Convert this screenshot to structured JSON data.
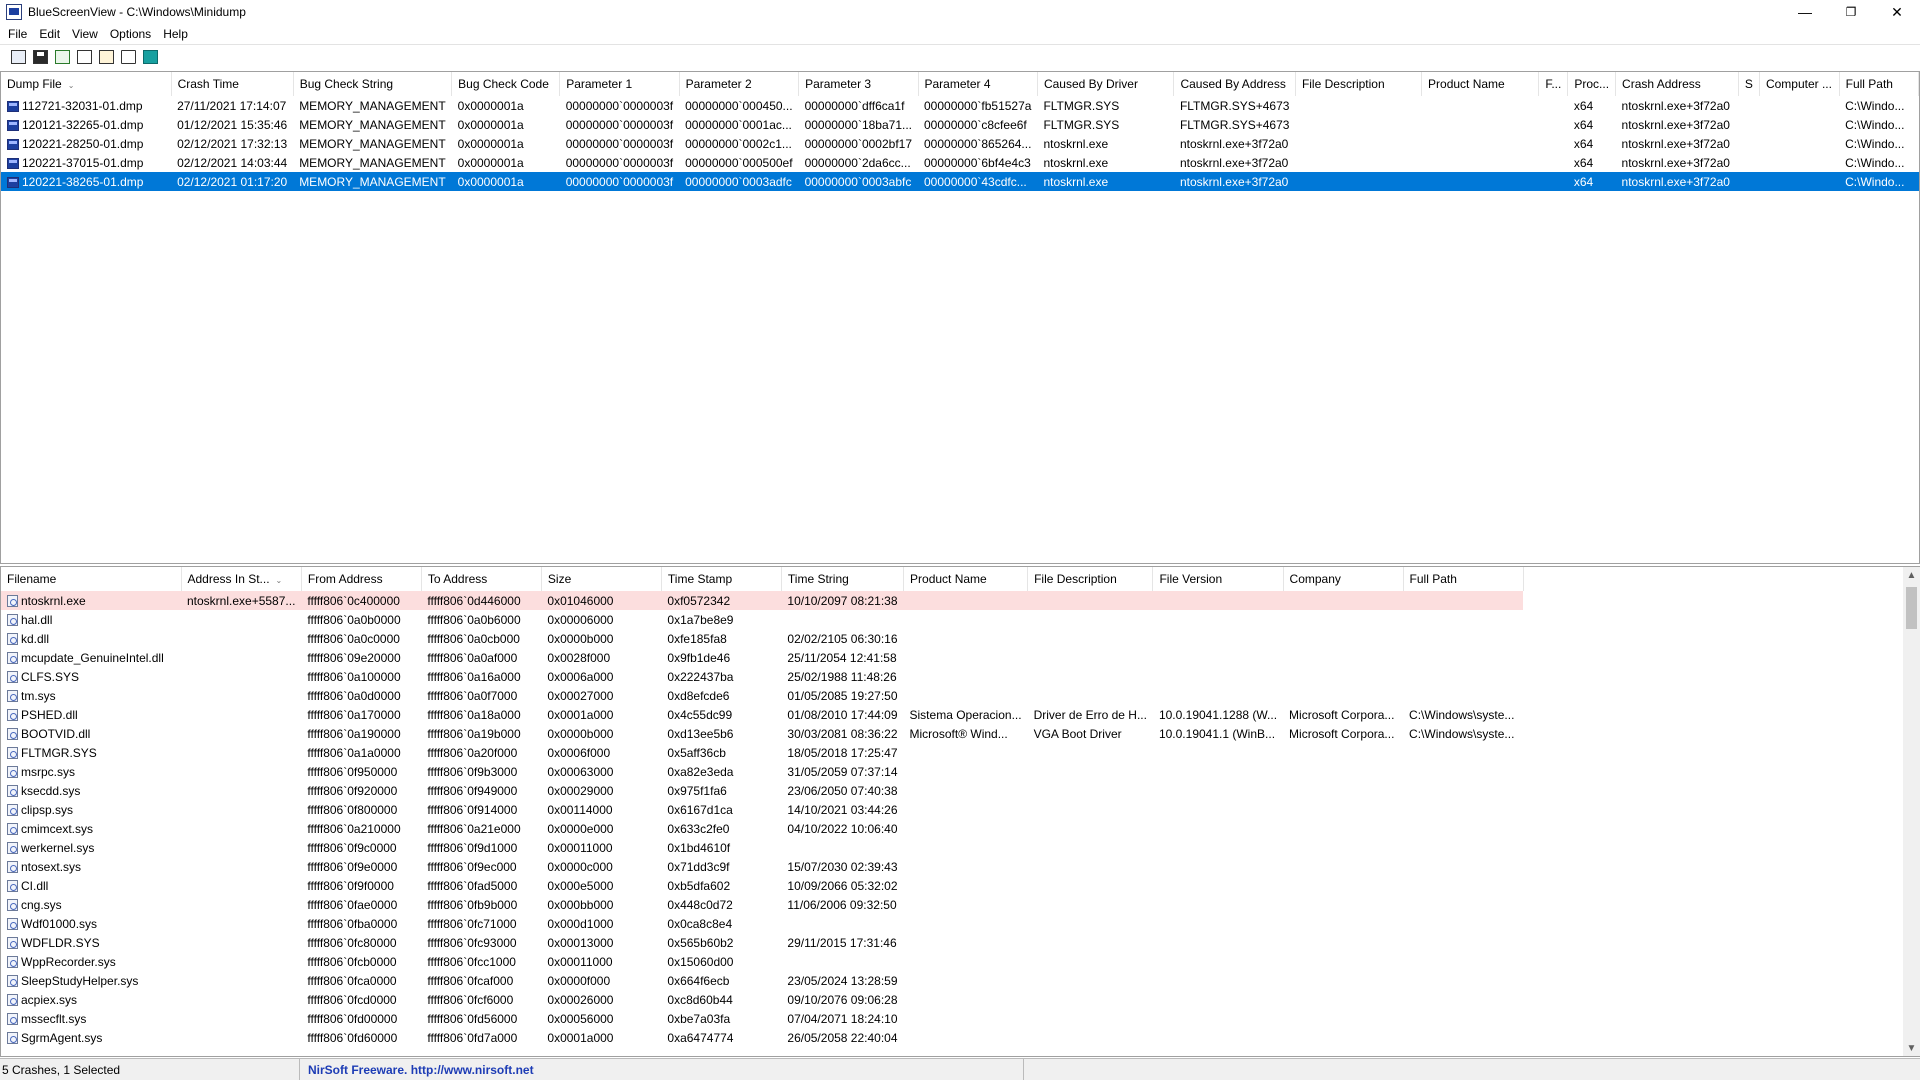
{
  "window": {
    "app_name": "BlueScreenView",
    "path": "C:\\Windows\\Minidump",
    "title_separator": " - "
  },
  "window_controls": {
    "minimize": "—",
    "restore": "❐",
    "close": "✕"
  },
  "menu": [
    "File",
    "Edit",
    "View",
    "Options",
    "Help"
  ],
  "toolbar": [
    "html-report-icon",
    "save-icon",
    "refresh-icon",
    "copy-icon",
    "properties-icon",
    "find-icon",
    "exit-icon"
  ],
  "crashes": {
    "columns": [
      "Dump File",
      "Crash Time",
      "Bug Check String",
      "Bug Check Code",
      "Parameter 1",
      "Parameter 2",
      "Parameter 3",
      "Parameter 4",
      "Caused By Driver",
      "Caused By Address",
      "File Description",
      "Product Name",
      "F...",
      "Proc...",
      "Crash Address",
      "S",
      "Computer ...",
      "Full Path"
    ],
    "sort_indicator": "⌄",
    "rows": [
      [
        "112721-32031-01.dmp",
        "27/11/2021 17:14:07",
        "MEMORY_MANAGEMENT",
        "0x0000001a",
        "00000000`0000003f",
        "00000000`000450...",
        "00000000`dff6ca1f",
        "00000000`fb51527a",
        "FLTMGR.SYS",
        "FLTMGR.SYS+4673",
        "",
        "",
        "",
        "x64",
        "ntoskrnl.exe+3f72a0",
        "",
        "",
        "C:\\Windo..."
      ],
      [
        "120121-32265-01.dmp",
        "01/12/2021 15:35:46",
        "MEMORY_MANAGEMENT",
        "0x0000001a",
        "00000000`0000003f",
        "00000000`0001ac...",
        "00000000`18ba71...",
        "00000000`c8cfee6f",
        "FLTMGR.SYS",
        "FLTMGR.SYS+4673",
        "",
        "",
        "",
        "x64",
        "ntoskrnl.exe+3f72a0",
        "",
        "",
        "C:\\Windo..."
      ],
      [
        "120221-28250-01.dmp",
        "02/12/2021 17:32:13",
        "MEMORY_MANAGEMENT",
        "0x0000001a",
        "00000000`0000003f",
        "00000000`0002c1...",
        "00000000`0002bf17",
        "00000000`865264...",
        "ntoskrnl.exe",
        "ntoskrnl.exe+3f72a0",
        "",
        "",
        "",
        "x64",
        "ntoskrnl.exe+3f72a0",
        "",
        "",
        "C:\\Windo..."
      ],
      [
        "120221-37015-01.dmp",
        "02/12/2021 14:03:44",
        "MEMORY_MANAGEMENT",
        "0x0000001a",
        "00000000`0000003f",
        "00000000`000500ef",
        "00000000`2da6cc...",
        "00000000`6bf4e4c3",
        "ntoskrnl.exe",
        "ntoskrnl.exe+3f72a0",
        "",
        "",
        "",
        "x64",
        "ntoskrnl.exe+3f72a0",
        "",
        "",
        "C:\\Windo..."
      ],
      [
        "120221-38265-01.dmp",
        "02/12/2021 01:17:20",
        "MEMORY_MANAGEMENT",
        "0x0000001a",
        "00000000`0000003f",
        "00000000`0003adfc",
        "00000000`0003abfc",
        "00000000`43cdfc...",
        "ntoskrnl.exe",
        "ntoskrnl.exe+3f72a0",
        "",
        "",
        "",
        "x64",
        "ntoskrnl.exe+3f72a0",
        "",
        "",
        "C:\\Windo..."
      ]
    ],
    "selected_index": 4
  },
  "drivers": {
    "columns": [
      "Filename",
      "Address In St...",
      "From Address",
      "To Address",
      "Size",
      "Time Stamp",
      "Time String",
      "Product Name",
      "File Description",
      "File Version",
      "Company",
      "Full Path"
    ],
    "sort_indicator": "⌄",
    "highlight_index": 0,
    "rows": [
      [
        "ntoskrnl.exe",
        "ntoskrnl.exe+5587...",
        "fffff806`0c400000",
        "fffff806`0d446000",
        "0x01046000",
        "0xf0572342",
        "10/10/2097 08:21:38",
        "",
        "",
        "",
        "",
        ""
      ],
      [
        "hal.dll",
        "",
        "fffff806`0a0b0000",
        "fffff806`0a0b6000",
        "0x00006000",
        "0x1a7be8e9",
        "",
        "",
        "",
        "",
        "",
        ""
      ],
      [
        "kd.dll",
        "",
        "fffff806`0a0c0000",
        "fffff806`0a0cb000",
        "0x0000b000",
        "0xfe185fa8",
        "02/02/2105 06:30:16",
        "",
        "",
        "",
        "",
        ""
      ],
      [
        "mcupdate_GenuineIntel.dll",
        "",
        "fffff806`09e20000",
        "fffff806`0a0af000",
        "0x0028f000",
        "0x9fb1de46",
        "25/11/2054 12:41:58",
        "",
        "",
        "",
        "",
        ""
      ],
      [
        "CLFS.SYS",
        "",
        "fffff806`0a100000",
        "fffff806`0a16a000",
        "0x0006a000",
        "0x222437ba",
        "25/02/1988 11:48:26",
        "",
        "",
        "",
        "",
        ""
      ],
      [
        "tm.sys",
        "",
        "fffff806`0a0d0000",
        "fffff806`0a0f7000",
        "0x00027000",
        "0xd8efcde6",
        "01/05/2085 19:27:50",
        "",
        "",
        "",
        "",
        ""
      ],
      [
        "PSHED.dll",
        "",
        "fffff806`0a170000",
        "fffff806`0a18a000",
        "0x0001a000",
        "0x4c55dc99",
        "01/08/2010 17:44:09",
        "Sistema Operacion...",
        "Driver de Erro de H...",
        "10.0.19041.1288 (W...",
        "Microsoft Corpora...",
        "C:\\Windows\\syste..."
      ],
      [
        "BOOTVID.dll",
        "",
        "fffff806`0a190000",
        "fffff806`0a19b000",
        "0x0000b000",
        "0xd13ee5b6",
        "30/03/2081 08:36:22",
        "Microsoft® Wind...",
        "VGA Boot Driver",
        "10.0.19041.1 (WinB...",
        "Microsoft Corpora...",
        "C:\\Windows\\syste..."
      ],
      [
        "FLTMGR.SYS",
        "",
        "fffff806`0a1a0000",
        "fffff806`0a20f000",
        "0x0006f000",
        "0x5aff36cb",
        "18/05/2018 17:25:47",
        "",
        "",
        "",
        "",
        ""
      ],
      [
        "msrpc.sys",
        "",
        "fffff806`0f950000",
        "fffff806`0f9b3000",
        "0x00063000",
        "0xa82e3eda",
        "31/05/2059 07:37:14",
        "",
        "",
        "",
        "",
        ""
      ],
      [
        "ksecdd.sys",
        "",
        "fffff806`0f920000",
        "fffff806`0f949000",
        "0x00029000",
        "0x975f1fa6",
        "23/06/2050 07:40:38",
        "",
        "",
        "",
        "",
        ""
      ],
      [
        "clipsp.sys",
        "",
        "fffff806`0f800000",
        "fffff806`0f914000",
        "0x00114000",
        "0x6167d1ca",
        "14/10/2021 03:44:26",
        "",
        "",
        "",
        "",
        ""
      ],
      [
        "cmimcext.sys",
        "",
        "fffff806`0a210000",
        "fffff806`0a21e000",
        "0x0000e000",
        "0x633c2fe0",
        "04/10/2022 10:06:40",
        "",
        "",
        "",
        "",
        ""
      ],
      [
        "werkernel.sys",
        "",
        "fffff806`0f9c0000",
        "fffff806`0f9d1000",
        "0x00011000",
        "0x1bd4610f",
        "",
        "",
        "",
        "",
        "",
        ""
      ],
      [
        "ntosext.sys",
        "",
        "fffff806`0f9e0000",
        "fffff806`0f9ec000",
        "0x0000c000",
        "0x71dd3c9f",
        "15/07/2030 02:39:43",
        "",
        "",
        "",
        "",
        ""
      ],
      [
        "CI.dll",
        "",
        "fffff806`0f9f0000",
        "fffff806`0fad5000",
        "0x000e5000",
        "0xb5dfa602",
        "10/09/2066 05:32:02",
        "",
        "",
        "",
        "",
        ""
      ],
      [
        "cng.sys",
        "",
        "fffff806`0fae0000",
        "fffff806`0fb9b000",
        "0x000bb000",
        "0x448c0d72",
        "11/06/2006 09:32:50",
        "",
        "",
        "",
        "",
        ""
      ],
      [
        "Wdf01000.sys",
        "",
        "fffff806`0fba0000",
        "fffff806`0fc71000",
        "0x000d1000",
        "0x0ca8c8e4",
        "",
        "",
        "",
        "",
        "",
        ""
      ],
      [
        "WDFLDR.SYS",
        "",
        "fffff806`0fc80000",
        "fffff806`0fc93000",
        "0x00013000",
        "0x565b60b2",
        "29/11/2015 17:31:46",
        "",
        "",
        "",
        "",
        ""
      ],
      [
        "WppRecorder.sys",
        "",
        "fffff806`0fcb0000",
        "fffff806`0fcc1000",
        "0x00011000",
        "0x15060d00",
        "",
        "",
        "",
        "",
        "",
        ""
      ],
      [
        "SleepStudyHelper.sys",
        "",
        "fffff806`0fca0000",
        "fffff806`0fcaf000",
        "0x0000f000",
        "0x664f6ecb",
        "23/05/2024 13:28:59",
        "",
        "",
        "",
        "",
        ""
      ],
      [
        "acpiex.sys",
        "",
        "fffff806`0fcd0000",
        "fffff806`0fcf6000",
        "0x00026000",
        "0xc8d60b44",
        "09/10/2076 09:06:28",
        "",
        "",
        "",
        "",
        ""
      ],
      [
        "mssecflt.sys",
        "",
        "fffff806`0fd00000",
        "fffff806`0fd56000",
        "0x00056000",
        "0xbe7a03fa",
        "07/04/2071 18:24:10",
        "",
        "",
        "",
        "",
        ""
      ],
      [
        "SgrmAgent.sys",
        "",
        "fffff806`0fd60000",
        "fffff806`0fd7a000",
        "0x0001a000",
        "0xa6474774",
        "26/05/2058 22:40:04",
        "",
        "",
        "",
        "",
        ""
      ]
    ]
  },
  "status": {
    "summary": "5 Crashes, 1 Selected",
    "vendor": "NirSoft Freeware.  http://www.nirsoft.net"
  }
}
